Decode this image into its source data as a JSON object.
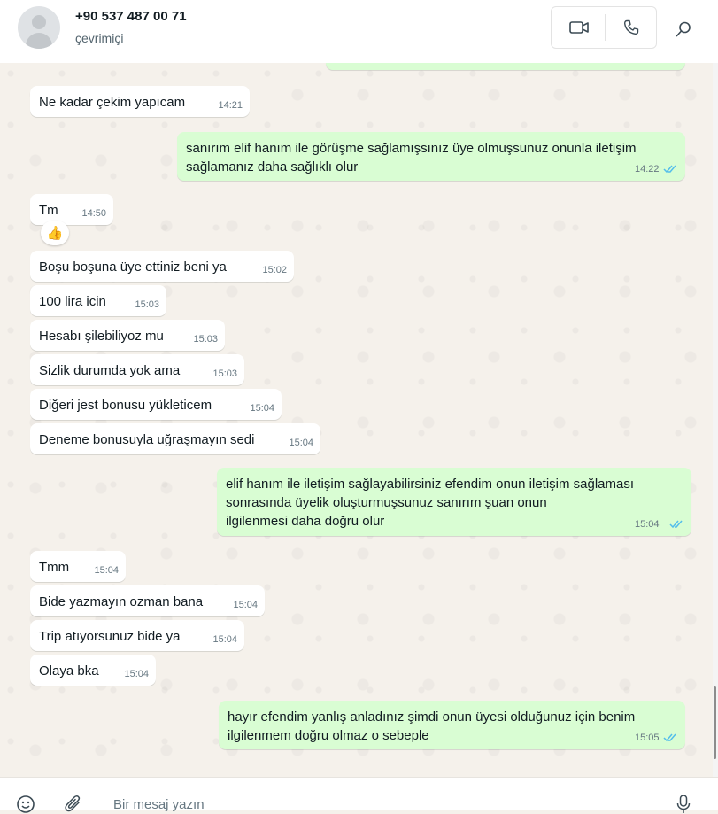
{
  "contact": {
    "name": "+90 537 487 00 71",
    "status": "çevrimiçi"
  },
  "icons": {
    "video": "video-camera-icon",
    "phone": "phone-icon",
    "search": "search-icon",
    "emoji": "emoji-icon",
    "attach": "paperclip-icon",
    "mic": "microphone-icon",
    "read_ticks": "double-check-icon"
  },
  "colors": {
    "incoming_bubble": "#ffffff",
    "outgoing_bubble": "#d9fdd3",
    "read_ticks": "#53bdeb"
  },
  "messages": [
    {
      "dir": "in",
      "text": "Ne kadar çekim yapıcam",
      "time": "14:21"
    },
    {
      "dir": "out",
      "text": "sanırım elif hanım ile görüşme sağlamışsınız üye olmuşsunuz onunla iletişim\nsağlamanız daha sağlıklı olur",
      "time": "14:22",
      "status": "read"
    },
    {
      "dir": "in",
      "text": "Tm",
      "time": "14:50",
      "reaction": "👍"
    },
    {
      "dir": "in",
      "text": "Boşu boşuna üye ettiniz beni ya",
      "time": "15:02"
    },
    {
      "dir": "in",
      "text": "100 lira icin",
      "time": "15:03"
    },
    {
      "dir": "in",
      "text": "Hesabı şilebiliyoz mu",
      "time": "15:03"
    },
    {
      "dir": "in",
      "text": "Sizlik durumda yok ama",
      "time": "15:03"
    },
    {
      "dir": "in",
      "text": "Diğeri jest bonusu yükleticem",
      "time": "15:04"
    },
    {
      "dir": "in",
      "text": "Deneme bonusuyla uğraşmayın sedi",
      "time": "15:04"
    },
    {
      "dir": "out",
      "text": "elif hanım ile iletişim sağlayabilirsiniz efendim onun iletişim sağlaması\nsonrasında üyelik oluşturmuşsunuz sanırım şuan onun\nilgilenmesi daha doğru olur",
      "time": "15:04",
      "status": "read"
    },
    {
      "dir": "in",
      "text": "Tmm",
      "time": "15:04"
    },
    {
      "dir": "in",
      "text": "Bide yazmayın ozman bana",
      "time": "15:04"
    },
    {
      "dir": "in",
      "text": "Trip atıyorsunuz bide ya",
      "time": "15:04"
    },
    {
      "dir": "in",
      "text": "Olaya bka",
      "time": "15:04"
    },
    {
      "dir": "out",
      "text": "hayır efendim yanlış anladınız şimdi onun üyesi olduğunuz için benim\nilgilenmem doğru olmaz o sebeple",
      "time": "15:05",
      "status": "read"
    }
  ],
  "composer": {
    "placeholder": "Bir mesaj yazın"
  }
}
